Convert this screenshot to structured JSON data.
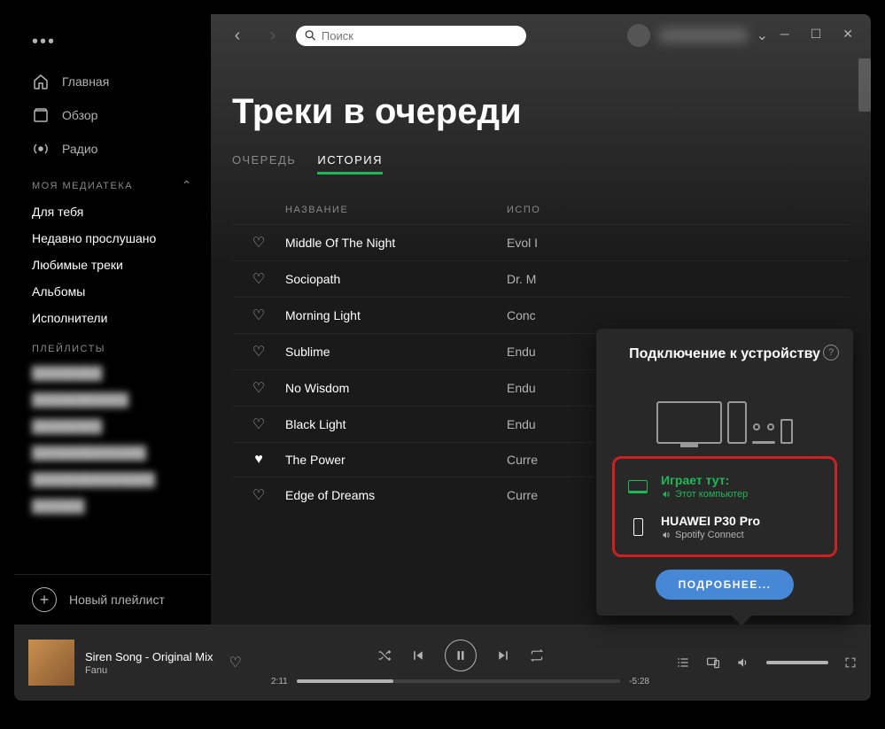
{
  "search": {
    "placeholder": "Поиск"
  },
  "sidebar": {
    "nav": [
      {
        "label": "Главная",
        "icon": "home"
      },
      {
        "label": "Обзор",
        "icon": "browse"
      },
      {
        "label": "Радио",
        "icon": "radio"
      }
    ],
    "library_section": "МОЯ МЕДИАТЕКА",
    "library": [
      "Для тебя",
      "Недавно прослушано",
      "Любимые треки",
      "Альбомы",
      "Исполнители"
    ],
    "playlists_section": "ПЛЕЙЛИСТЫ",
    "new_playlist": "Новый плейлист"
  },
  "page": {
    "title": "Треки в очереди",
    "tabs": [
      {
        "label": "ОЧЕРЕДЬ",
        "active": false
      },
      {
        "label": "ИСТОРИЯ",
        "active": true
      }
    ],
    "columns": {
      "title": "НАЗВАНИЕ",
      "artist": "ИСПО"
    },
    "tracks": [
      {
        "title": "Middle Of The Night",
        "artist": "Evol I",
        "liked": false
      },
      {
        "title": "Sociopath",
        "artist": "Dr. M",
        "liked": false
      },
      {
        "title": "Morning Light",
        "artist": "Conc",
        "liked": false
      },
      {
        "title": "Sublime",
        "artist": "Endu",
        "liked": false
      },
      {
        "title": "No Wisdom",
        "artist": "Endu",
        "liked": false
      },
      {
        "title": "Black Light",
        "artist": "Endu",
        "liked": false
      },
      {
        "title": "The Power",
        "artist": "Curre",
        "liked": true
      },
      {
        "title": "Edge of Dreams",
        "artist": "Curre",
        "liked": false
      }
    ]
  },
  "player": {
    "track": "Siren Song - Original Mix",
    "artist": "Fanu",
    "elapsed": "2:11",
    "remaining": "-5:28"
  },
  "devices": {
    "title": "Подключение к устройству",
    "list": [
      {
        "name": "Играет тут:",
        "sub": "Этот компьютер",
        "active": true,
        "type": "laptop"
      },
      {
        "name": "HUAWEI P30 Pro",
        "sub": "Spotify Connect",
        "active": false,
        "type": "phone"
      }
    ],
    "more_button": "ПОДРОБНЕЕ..."
  }
}
